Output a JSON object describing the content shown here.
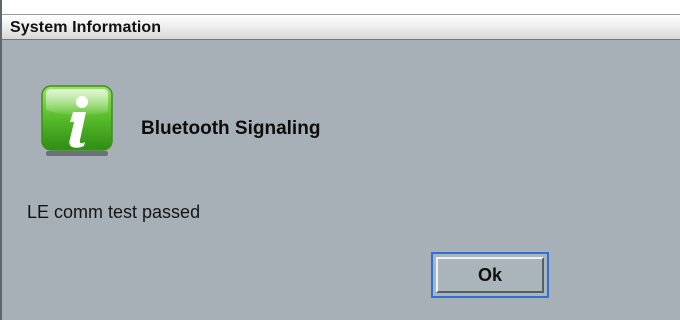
{
  "window": {
    "title": "System Information"
  },
  "dialog": {
    "icon": "info-icon",
    "heading": "Bluetooth Signaling",
    "message": "LE comm test passed",
    "ok_label": "Ok"
  },
  "colors": {
    "dialog_background": "#a7b0b6",
    "icon_green": "#55b82a",
    "button_focus": "#2f6fd8"
  }
}
